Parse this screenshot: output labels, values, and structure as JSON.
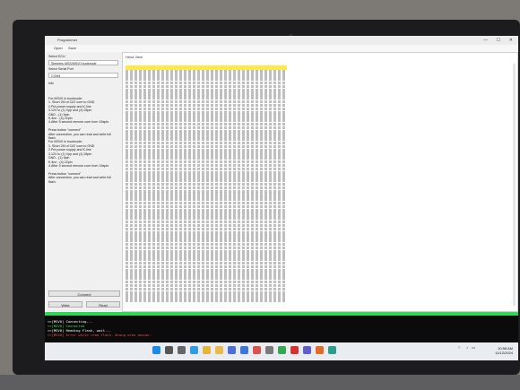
{
  "window": {
    "title": "Programmer",
    "minimize": "—",
    "maximize": "☐",
    "close": "✕"
  },
  "menu": [
    "Open",
    "Save"
  ],
  "left": {
    "select_ecu": "Select ECU",
    "ecu_value": "Siemens MSS/MSV0 bootmode",
    "select_port": "Select Serial Port",
    "port_value": "COM4",
    "info_label": "Info",
    "instructions": "For MSV0 in bootmode:\n1. Short 2M of CAT core to GND\n2.Put power supply and K-line\n3.12V to (1) Vpp and (4) 28pin\nGND - (1) 9pin\nK-line - (4) 22pin\n4.After 5 second remove core from 19apin.\n\nPress button \"connect\"\nAfter connection, you can read and write full flash.\nFor MSV0 in bootmode:\n1. Short 2M of CAT core to GND\n2.Put power supply and K-line\n3.12V to (1) Vpp and (4) 28pin\nGND - (1) 9pin\nK-line - (4) 22pin\n4.After 5 second remove core from 19apin.\n\nPress button \"connect\"\nAfter connection, you can read and write full flash.",
    "connect": "Connect",
    "write": "Write",
    "read": "Read"
  },
  "hex": {
    "title": "Hexa View"
  },
  "log": [
    {
      "text": ">>[MSV0] Connecting...",
      "color": "#ffffff"
    },
    {
      "text": ">>[MSV0] Connected",
      "color": "#39e05b"
    },
    {
      "text": ">>[MSV0] Reading Flash, wait...",
      "color": "#ffffff"
    },
    {
      "text": ">>[MSV0] Error while read flash. Wrong echo answer.",
      "color": "#ff4b4b"
    }
  ],
  "progress_percent": 100,
  "taskbar": {
    "icons": [
      "windows-icon",
      "search-icon",
      "taskview-icon",
      "edge-icon",
      "chrome-icon",
      "explorer-icon",
      "store-icon",
      "mail-icon",
      "photos-icon",
      "settings-icon",
      "chrome2-icon",
      "opera-icon",
      "teams-icon",
      "media-icon",
      "app-icon"
    ],
    "time": "10:58 AM",
    "date": "11/12/2024"
  }
}
